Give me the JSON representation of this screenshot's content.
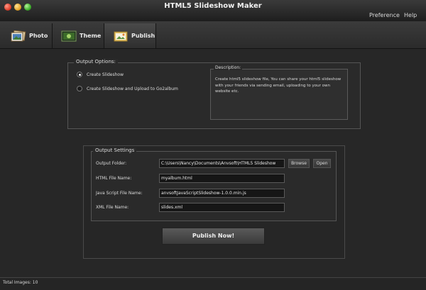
{
  "window": {
    "title": "HTML5 Slideshow Maker"
  },
  "menu": {
    "preference": "Preference",
    "help": "Help"
  },
  "tabs": [
    {
      "label": "Photo",
      "icon": "photo-icon"
    },
    {
      "label": "Theme",
      "icon": "theme-icon"
    },
    {
      "label": "Publish",
      "icon": "publish-icon",
      "active": true
    }
  ],
  "output_options": {
    "legend": "Output Options:",
    "options": [
      {
        "label": "Create Slideshow",
        "checked": true
      },
      {
        "label": "Create Slideshow and Upload to Go2album",
        "checked": false
      }
    ],
    "description": {
      "legend": "Description:",
      "text": "Create html5 slideshow file, You can share your html5 slideshow with your friends via sending email, uploading to your own website etc."
    }
  },
  "output_settings": {
    "legend": "Output Settings",
    "folder": {
      "label": "Output Folder:",
      "value": "C:\\Users\\Nancy\\Documents\\Anvsoft\\HTML5 Slideshow"
    },
    "browse": "Browse",
    "open": "Open",
    "html_file": {
      "label": "HTML File Name:",
      "value": "myalbum.html"
    },
    "js_file": {
      "label": "Java Script File Name:",
      "value": "anvsoftJavaScriptSlideshow-1.0.0.min.js"
    },
    "xml_file": {
      "label": "XML File Name:",
      "value": "slides.xml"
    }
  },
  "actions": {
    "publish": "Publish Now!"
  },
  "status": {
    "total_images": "Total Images: 10"
  }
}
